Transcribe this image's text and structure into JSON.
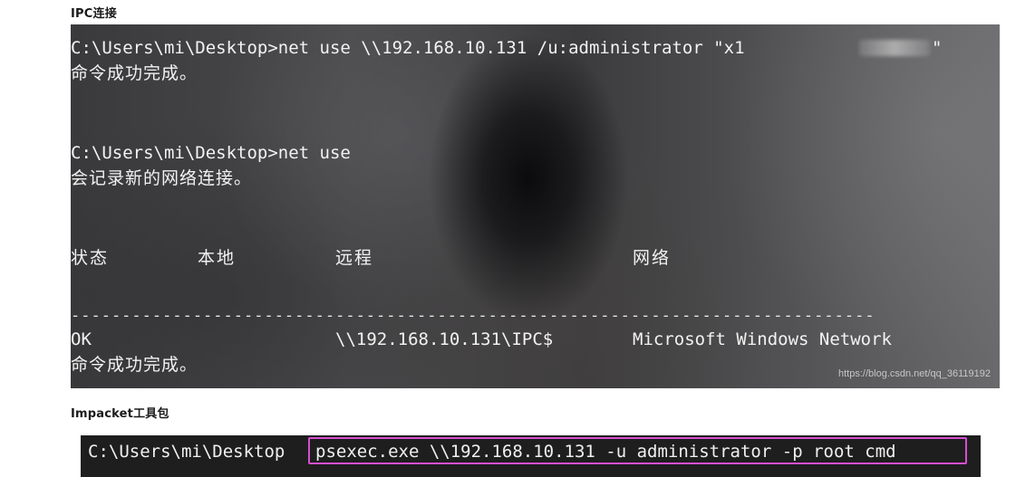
{
  "headings": {
    "ipc": "IPC连接",
    "impacket": "Impacket工具包"
  },
  "terminal1": {
    "cmd1_prefix": "C:\\Users\\mi\\Desktop>net use \\\\192.168.10.131 /u:administrator \"x1",
    "cmd1_suffix": "\"",
    "ok_line_1": "命令成功完成。",
    "cmd2": "C:\\Users\\mi\\Desktop>net use",
    "new_connections": "会记录新的网络连接。",
    "columns": {
      "status": "状态",
      "local": "本地",
      "remote": "远程",
      "network": "网络"
    },
    "dashes": "-------------------------------------------------------------------------------",
    "row": {
      "status": "OK",
      "remote": "\\\\192.168.10.131\\IPC$",
      "network": "Microsoft Windows Network"
    },
    "ok_line_2": "命令成功完成。",
    "watermark": "https://blog.csdn.net/qq_36119192"
  },
  "terminal2": {
    "prompt": "C:\\Users\\mi\\Desktop",
    "command": "psexec.exe \\\\192.168.10.131 -u administrator -p root cmd",
    "highlight_color": "#d64fd0"
  }
}
